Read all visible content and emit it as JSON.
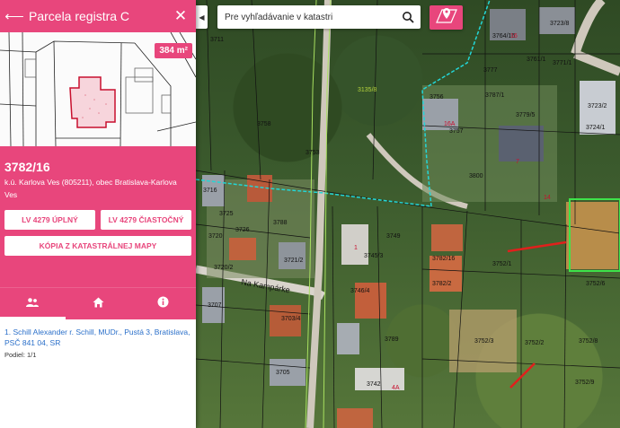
{
  "panel": {
    "title": "Parcela registra C",
    "area_badge": "384 m²",
    "parcel_number": "3782/16",
    "location": "k.ú. Karlova Ves (805211), obec Bratislava-Karlova Ves",
    "buttons": {
      "lv_full": "LV 4279 ÚPLNÝ",
      "lv_partial": "LV 4279 ČIASTOČNÝ",
      "copy_map": "KÓPIA Z KATASTRÁLNEJ MAPY"
    },
    "tabs": [
      {
        "icon": "people-icon",
        "active": true
      },
      {
        "icon": "home-icon",
        "active": false
      },
      {
        "icon": "info-icon",
        "active": false
      }
    ],
    "owner": "1. Schill Alexander r. Schill, MUDr., Pustá 3, Bratislava, PSČ 841 04, SR",
    "share": "Podiel: 1/1"
  },
  "search": {
    "placeholder": "Pre vyhľadávanie v katastri"
  },
  "map_labels": {
    "parcels": [
      "3716",
      "3718/2",
      "3720/2",
      "3721/2",
      "3703/4",
      "3707",
      "3705",
      "3742",
      "3745/3",
      "3746/4",
      "3749",
      "3752/1",
      "3752/2",
      "3752/3",
      "3752/8",
      "3752/9",
      "3756",
      "3757",
      "3761/1",
      "3764/16",
      "3771/1",
      "3777",
      "3787/1",
      "3723/2",
      "3723/8",
      "3724/1",
      "3725",
      "3726",
      "3752/6",
      "3720",
      "3711",
      "3779/5",
      "3782/16",
      "3782/2",
      "3788",
      "3789",
      "3800",
      "3758",
      "3753"
    ],
    "red_parcels": [
      "14",
      "16A",
      "4A",
      "1",
      "7",
      "16"
    ],
    "street": "Na Kampárke",
    "green_label": "3135/8"
  },
  "colors": {
    "accent": "#e8467c",
    "owner_link": "#2a6fc9"
  }
}
